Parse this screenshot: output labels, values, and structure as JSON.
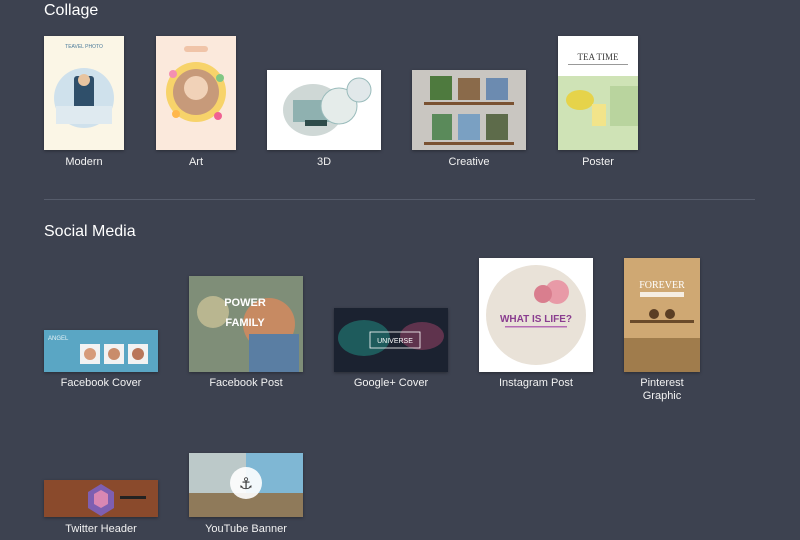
{
  "collage": {
    "title": "Collage",
    "items": [
      {
        "label": "Modern",
        "thumb_text": "TEAVEL PHOTO"
      },
      {
        "label": "Art"
      },
      {
        "label": "3D"
      },
      {
        "label": "Creative"
      },
      {
        "label": "Poster",
        "thumb_text": "TEA TIME"
      }
    ]
  },
  "social": {
    "title": "Social Media",
    "items": [
      {
        "label": "Facebook Cover",
        "thumb_text": "ANGEL"
      },
      {
        "label": "Facebook Post",
        "thumb_text": "POWER",
        "thumb_text2": "FAMILY"
      },
      {
        "label": "Google+ Cover",
        "thumb_text": "UNIVERSE"
      },
      {
        "label": "Instagram Post",
        "thumb_text": "WHAT IS LIFE?"
      },
      {
        "label": "Pinterest Graphic",
        "thumb_text": "FOREVER"
      },
      {
        "label": "Twitter Header"
      },
      {
        "label": "YouTube Banner"
      }
    ]
  },
  "colors": {
    "background": "#3d4250",
    "divider": "#565c6b",
    "label": "#f2f2f2"
  }
}
